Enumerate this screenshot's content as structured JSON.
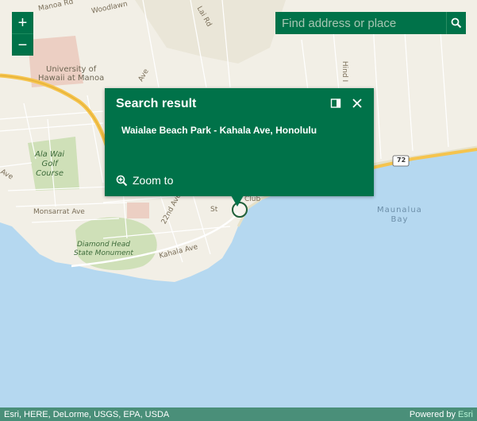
{
  "map": {
    "labels": {
      "manoa_rd": "Manoa Rd",
      "woodlawn": "Woodlawn",
      "lai_rd": "Lai Rd",
      "university": "University of\nHawaii at Manoa",
      "ala_wai": "Ala Wai\nGolf\nCourse",
      "monsarrat": "Monsarrat Ave",
      "diamond_head": "Diamond Head\nState Monument",
      "kahala": "Kahala Ave",
      "street_22nd": "22nd Ave",
      "kapahulu_ave": "Ave",
      "waialae_ave": "Ave",
      "maunalua_bay": "Maunalua\nBay",
      "club": "Club",
      "st": "St",
      "hind": "Hind I",
      "highway_72": "72"
    }
  },
  "zoom": {
    "in_label": "+",
    "out_label": "−"
  },
  "search": {
    "placeholder": "Find address or place",
    "icon": "search-icon"
  },
  "popup": {
    "title": "Search result",
    "content": "Waialae Beach Park - Kahala Ave, Honolulu",
    "zoom_label": "Zoom to",
    "icons": {
      "dock": "dock-icon",
      "close": "close-icon",
      "zoom": "zoom-to-icon"
    }
  },
  "attribution": {
    "sources": "Esri, HERE, DeLorme, USGS, EPA, USDA",
    "powered_by": "Powered by",
    "brand": "Esri"
  },
  "colors": {
    "accent": "#007249",
    "land": "#f2efe6",
    "water": "#b5d8f0",
    "park": "#cfe0b8",
    "road_major": "#f5c44e",
    "attribution_bar": "#4a8f79"
  }
}
